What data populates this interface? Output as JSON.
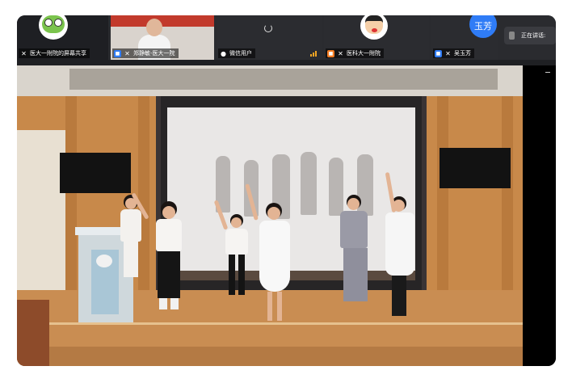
{
  "participants": [
    {
      "name": "医大一附院的屏幕共享",
      "avatar": "frog-avatar-icon"
    },
    {
      "name": "郑静敏-医大一院",
      "avatar": "camera-video",
      "badge": "host"
    },
    {
      "name": "微信用户",
      "avatar": "loading-spinner-icon"
    },
    {
      "name": "医科大一附院",
      "avatar": "cartoon-avatar-icon",
      "badge": "cohost"
    },
    {
      "name": "吴玉芳",
      "avatar_text": "玉芳",
      "badge": "host"
    }
  ],
  "speaking": {
    "label": "正在讲话:"
  },
  "colors": {
    "window_bg": "#1f2023",
    "host_badge": "#2f7cf6",
    "cohost_badge": "#f27b22",
    "avatar_blue": "#2f7cf6"
  }
}
